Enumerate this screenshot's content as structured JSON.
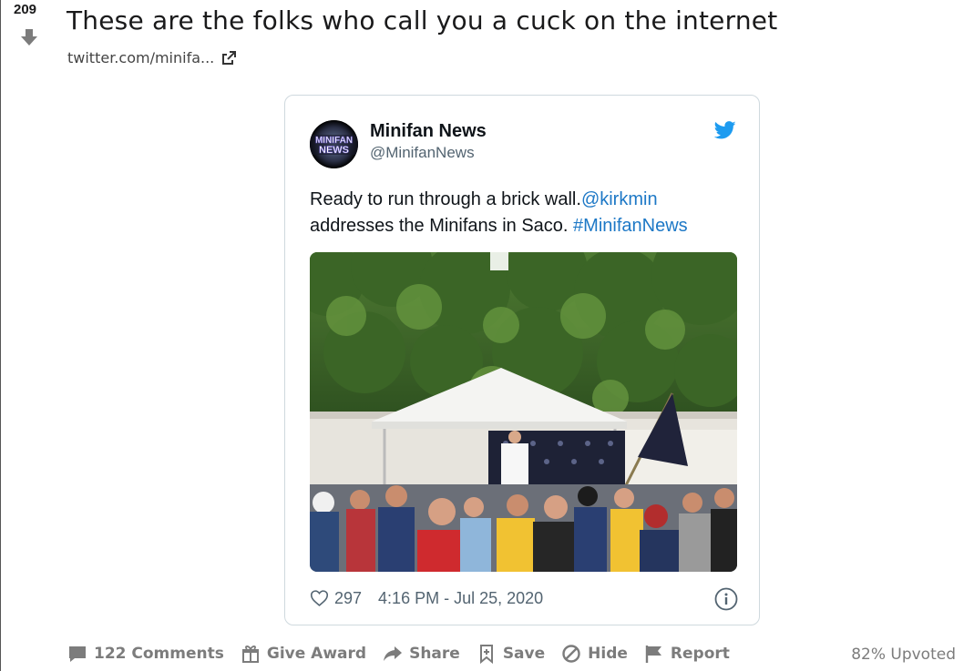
{
  "post": {
    "score": "209",
    "title": "These are the folks who call you a cuck on the internet",
    "link_text": "twitter.com/minifa..."
  },
  "tweet": {
    "author_name": "Minifan News",
    "author_handle": "@MinifanNews",
    "avatar_text": "MINIFAN NEWS",
    "text_part1": "Ready to run through a brick wall.",
    "mention": "@kirkmin",
    "text_part2": "addresses the Minifans in Saco. ",
    "hashtag": "#MinifanNews",
    "likes": "297",
    "timestamp": "4:16 PM - Jul 25, 2020"
  },
  "actions": {
    "comments": "122 Comments",
    "give_award": "Give Award",
    "share": "Share",
    "save": "Save",
    "hide": "Hide",
    "report": "Report"
  },
  "upvoted": "82% Upvoted",
  "colors": {
    "link_blue": "#1d78c6",
    "twitter_blue": "#1d9bf0",
    "meta_gray": "#7c7c7c"
  },
  "icons": [
    "downvote-arrow-icon",
    "external-link-icon",
    "twitter-bird-icon",
    "heart-icon",
    "info-icon",
    "comment-icon",
    "gift-icon",
    "share-icon",
    "save-icon",
    "hide-icon",
    "report-icon"
  ]
}
